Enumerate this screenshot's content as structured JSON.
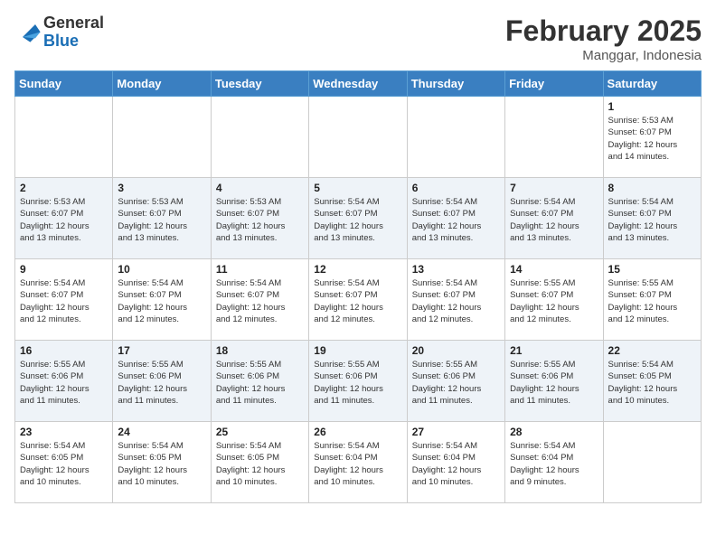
{
  "logo": {
    "line1": "General",
    "line2": "Blue"
  },
  "header": {
    "month_year": "February 2025",
    "location": "Manggar, Indonesia"
  },
  "days_of_week": [
    "Sunday",
    "Monday",
    "Tuesday",
    "Wednesday",
    "Thursday",
    "Friday",
    "Saturday"
  ],
  "weeks": [
    [
      {
        "day": "",
        "info": ""
      },
      {
        "day": "",
        "info": ""
      },
      {
        "day": "",
        "info": ""
      },
      {
        "day": "",
        "info": ""
      },
      {
        "day": "",
        "info": ""
      },
      {
        "day": "",
        "info": ""
      },
      {
        "day": "1",
        "info": "Sunrise: 5:53 AM\nSunset: 6:07 PM\nDaylight: 12 hours\nand 14 minutes."
      }
    ],
    [
      {
        "day": "2",
        "info": "Sunrise: 5:53 AM\nSunset: 6:07 PM\nDaylight: 12 hours\nand 13 minutes."
      },
      {
        "day": "3",
        "info": "Sunrise: 5:53 AM\nSunset: 6:07 PM\nDaylight: 12 hours\nand 13 minutes."
      },
      {
        "day": "4",
        "info": "Sunrise: 5:53 AM\nSunset: 6:07 PM\nDaylight: 12 hours\nand 13 minutes."
      },
      {
        "day": "5",
        "info": "Sunrise: 5:54 AM\nSunset: 6:07 PM\nDaylight: 12 hours\nand 13 minutes."
      },
      {
        "day": "6",
        "info": "Sunrise: 5:54 AM\nSunset: 6:07 PM\nDaylight: 12 hours\nand 13 minutes."
      },
      {
        "day": "7",
        "info": "Sunrise: 5:54 AM\nSunset: 6:07 PM\nDaylight: 12 hours\nand 13 minutes."
      },
      {
        "day": "8",
        "info": "Sunrise: 5:54 AM\nSunset: 6:07 PM\nDaylight: 12 hours\nand 13 minutes."
      }
    ],
    [
      {
        "day": "9",
        "info": "Sunrise: 5:54 AM\nSunset: 6:07 PM\nDaylight: 12 hours\nand 12 minutes."
      },
      {
        "day": "10",
        "info": "Sunrise: 5:54 AM\nSunset: 6:07 PM\nDaylight: 12 hours\nand 12 minutes."
      },
      {
        "day": "11",
        "info": "Sunrise: 5:54 AM\nSunset: 6:07 PM\nDaylight: 12 hours\nand 12 minutes."
      },
      {
        "day": "12",
        "info": "Sunrise: 5:54 AM\nSunset: 6:07 PM\nDaylight: 12 hours\nand 12 minutes."
      },
      {
        "day": "13",
        "info": "Sunrise: 5:54 AM\nSunset: 6:07 PM\nDaylight: 12 hours\nand 12 minutes."
      },
      {
        "day": "14",
        "info": "Sunrise: 5:55 AM\nSunset: 6:07 PM\nDaylight: 12 hours\nand 12 minutes."
      },
      {
        "day": "15",
        "info": "Sunrise: 5:55 AM\nSunset: 6:07 PM\nDaylight: 12 hours\nand 12 minutes."
      }
    ],
    [
      {
        "day": "16",
        "info": "Sunrise: 5:55 AM\nSunset: 6:06 PM\nDaylight: 12 hours\nand 11 minutes."
      },
      {
        "day": "17",
        "info": "Sunrise: 5:55 AM\nSunset: 6:06 PM\nDaylight: 12 hours\nand 11 minutes."
      },
      {
        "day": "18",
        "info": "Sunrise: 5:55 AM\nSunset: 6:06 PM\nDaylight: 12 hours\nand 11 minutes."
      },
      {
        "day": "19",
        "info": "Sunrise: 5:55 AM\nSunset: 6:06 PM\nDaylight: 12 hours\nand 11 minutes."
      },
      {
        "day": "20",
        "info": "Sunrise: 5:55 AM\nSunset: 6:06 PM\nDaylight: 12 hours\nand 11 minutes."
      },
      {
        "day": "21",
        "info": "Sunrise: 5:55 AM\nSunset: 6:06 PM\nDaylight: 12 hours\nand 11 minutes."
      },
      {
        "day": "22",
        "info": "Sunrise: 5:54 AM\nSunset: 6:05 PM\nDaylight: 12 hours\nand 10 minutes."
      }
    ],
    [
      {
        "day": "23",
        "info": "Sunrise: 5:54 AM\nSunset: 6:05 PM\nDaylight: 12 hours\nand 10 minutes."
      },
      {
        "day": "24",
        "info": "Sunrise: 5:54 AM\nSunset: 6:05 PM\nDaylight: 12 hours\nand 10 minutes."
      },
      {
        "day": "25",
        "info": "Sunrise: 5:54 AM\nSunset: 6:05 PM\nDaylight: 12 hours\nand 10 minutes."
      },
      {
        "day": "26",
        "info": "Sunrise: 5:54 AM\nSunset: 6:04 PM\nDaylight: 12 hours\nand 10 minutes."
      },
      {
        "day": "27",
        "info": "Sunrise: 5:54 AM\nSunset: 6:04 PM\nDaylight: 12 hours\nand 10 minutes."
      },
      {
        "day": "28",
        "info": "Sunrise: 5:54 AM\nSunset: 6:04 PM\nDaylight: 12 hours\nand 9 minutes."
      },
      {
        "day": "",
        "info": ""
      }
    ]
  ]
}
